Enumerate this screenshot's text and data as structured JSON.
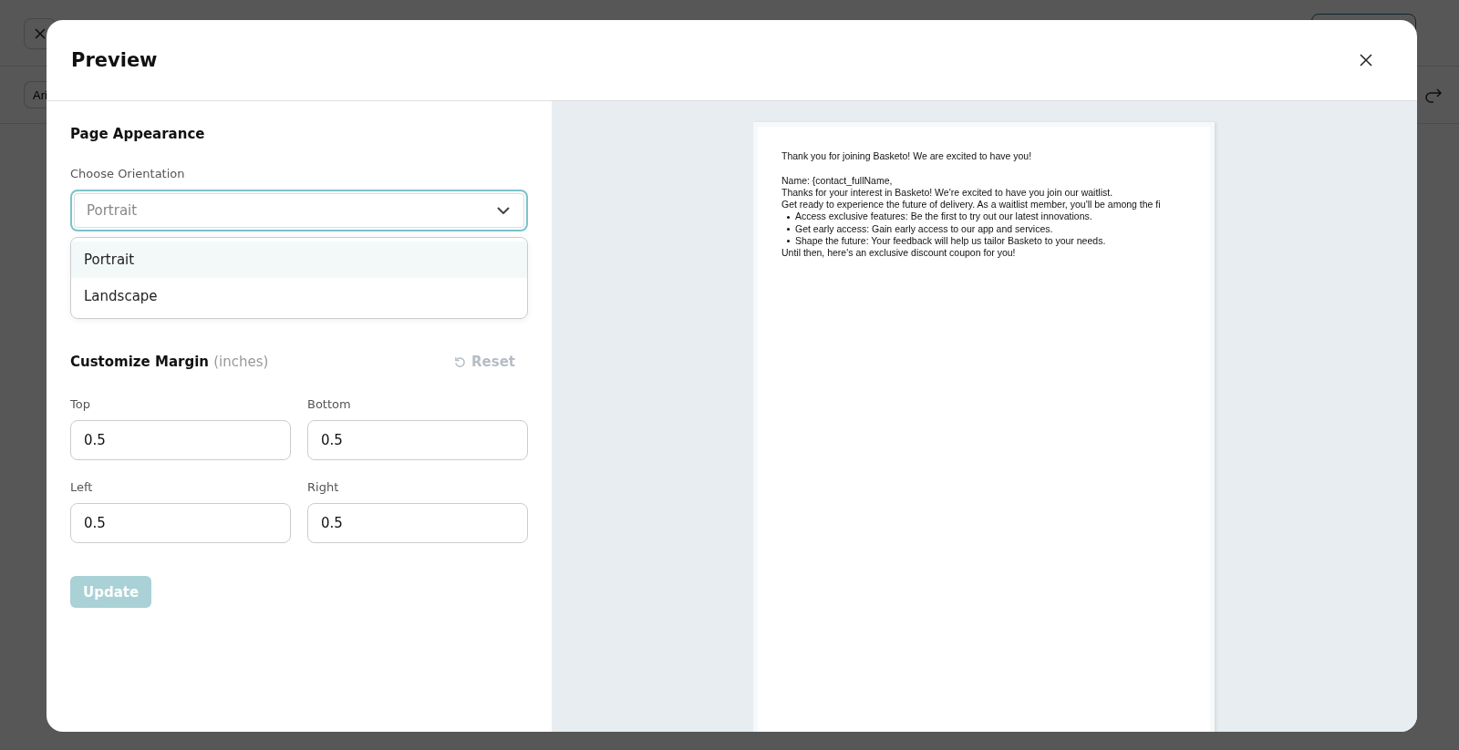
{
  "background": {
    "font_field": "Ari"
  },
  "modal": {
    "title": "Preview"
  },
  "page_appearance": {
    "heading": "Page Appearance",
    "orientation_label": "Choose Orientation",
    "orientation_value": "Portrait",
    "expanded": true,
    "options": [
      {
        "label": "Portrait",
        "selected": true
      },
      {
        "label": "Landscape",
        "selected": false
      }
    ]
  },
  "margins": {
    "heading": "Customize Margin",
    "unit": "(inches)",
    "reset": {
      "label": "Reset",
      "disabled": true
    },
    "fields": [
      {
        "label": "Top",
        "value": "0.5"
      },
      {
        "label": "Bottom",
        "value": "0.5"
      },
      {
        "label": "Left",
        "value": "0.5"
      },
      {
        "label": "Right",
        "value": "0.5"
      }
    ]
  },
  "update_button": {
    "label": "Update",
    "disabled": true
  },
  "preview": {
    "lines": [
      {
        "kind": "text",
        "text": "Thank you for joining Basketo! We are excited to have you!"
      },
      {
        "kind": "spacer"
      },
      {
        "kind": "text",
        "text": "Name: {contact_fullName,"
      },
      {
        "kind": "text",
        "text": "Thanks for your interest in Basketo! We're excited to have you join our waitlist."
      },
      {
        "kind": "text",
        "text": "Get ready to experience the future of delivery. As a waitlist member, you'll be among the fi"
      },
      {
        "kind": "bullet",
        "text": "Access exclusive features: Be the first to try out our latest innovations."
      },
      {
        "kind": "bullet",
        "text": "Get early access: Gain early access to our app and services."
      },
      {
        "kind": "bullet",
        "text": "Shape the future: Your feedback will help us tailor Basketo to your needs."
      },
      {
        "kind": "text",
        "text": "Until then, here's an exclusive discount coupon for you!"
      }
    ]
  }
}
